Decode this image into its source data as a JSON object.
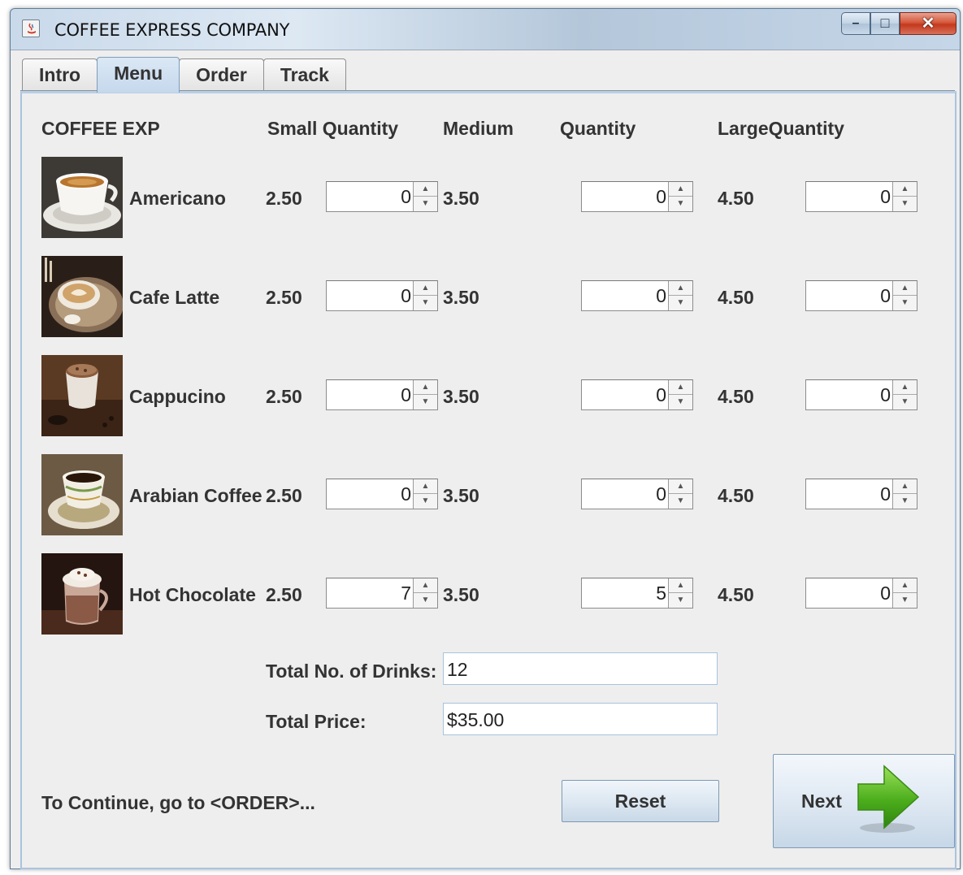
{
  "window": {
    "title": "COFFEE EXPRESS COMPANY",
    "minimize_glyph": "–",
    "maximize_glyph": "□",
    "close_glyph": "✕"
  },
  "tabs": [
    {
      "label": "Intro",
      "active": false
    },
    {
      "label": "Menu",
      "active": true
    },
    {
      "label": "Order",
      "active": false
    },
    {
      "label": "Track",
      "active": false
    }
  ],
  "headers": {
    "name": "COFFEE EXP",
    "small": "Small Quantity",
    "medium": "Medium",
    "medium_qty": "Quantity",
    "large": "LargeQuantity"
  },
  "items": [
    {
      "name": "Americano",
      "small_price": "2.50",
      "small_qty": "0",
      "medium_price": "3.50",
      "medium_qty": "0",
      "large_price": "4.50",
      "large_qty": "0",
      "image": "americano-image"
    },
    {
      "name": "Cafe Latte",
      "small_price": "2.50",
      "small_qty": "0",
      "medium_price": "3.50",
      "medium_qty": "0",
      "large_price": "4.50",
      "large_qty": "0",
      "image": "cafe-latte-image"
    },
    {
      "name": "Cappucino",
      "small_price": "2.50",
      "small_qty": "0",
      "medium_price": "3.50",
      "medium_qty": "0",
      "large_price": "4.50",
      "large_qty": "0",
      "image": "cappucino-image"
    },
    {
      "name": "Arabian Coffee",
      "small_price": "2.50",
      "small_qty": "0",
      "medium_price": "3.50",
      "medium_qty": "0",
      "large_price": "4.50",
      "large_qty": "0",
      "image": "arabian-coffee-image"
    },
    {
      "name": "Hot Chocolate",
      "small_price": "2.50",
      "small_qty": "7",
      "medium_price": "3.50",
      "medium_qty": "5",
      "large_price": "4.50",
      "large_qty": "0",
      "image": "hot-chocolate-image"
    }
  ],
  "totals": {
    "drinks_label": "Total No. of Drinks:",
    "drinks_value": "12",
    "price_label": "Total Price:",
    "price_value": "$35.00"
  },
  "footer": {
    "hint": "To Continue, go to <ORDER>...",
    "reset_label": "Reset",
    "next_label": "Next"
  },
  "colors": {
    "panel_bg": "#eeeeee",
    "tab_active": "#c5d8ec",
    "arrow_green": "#4cae1c",
    "close_red": "#c3391c"
  }
}
